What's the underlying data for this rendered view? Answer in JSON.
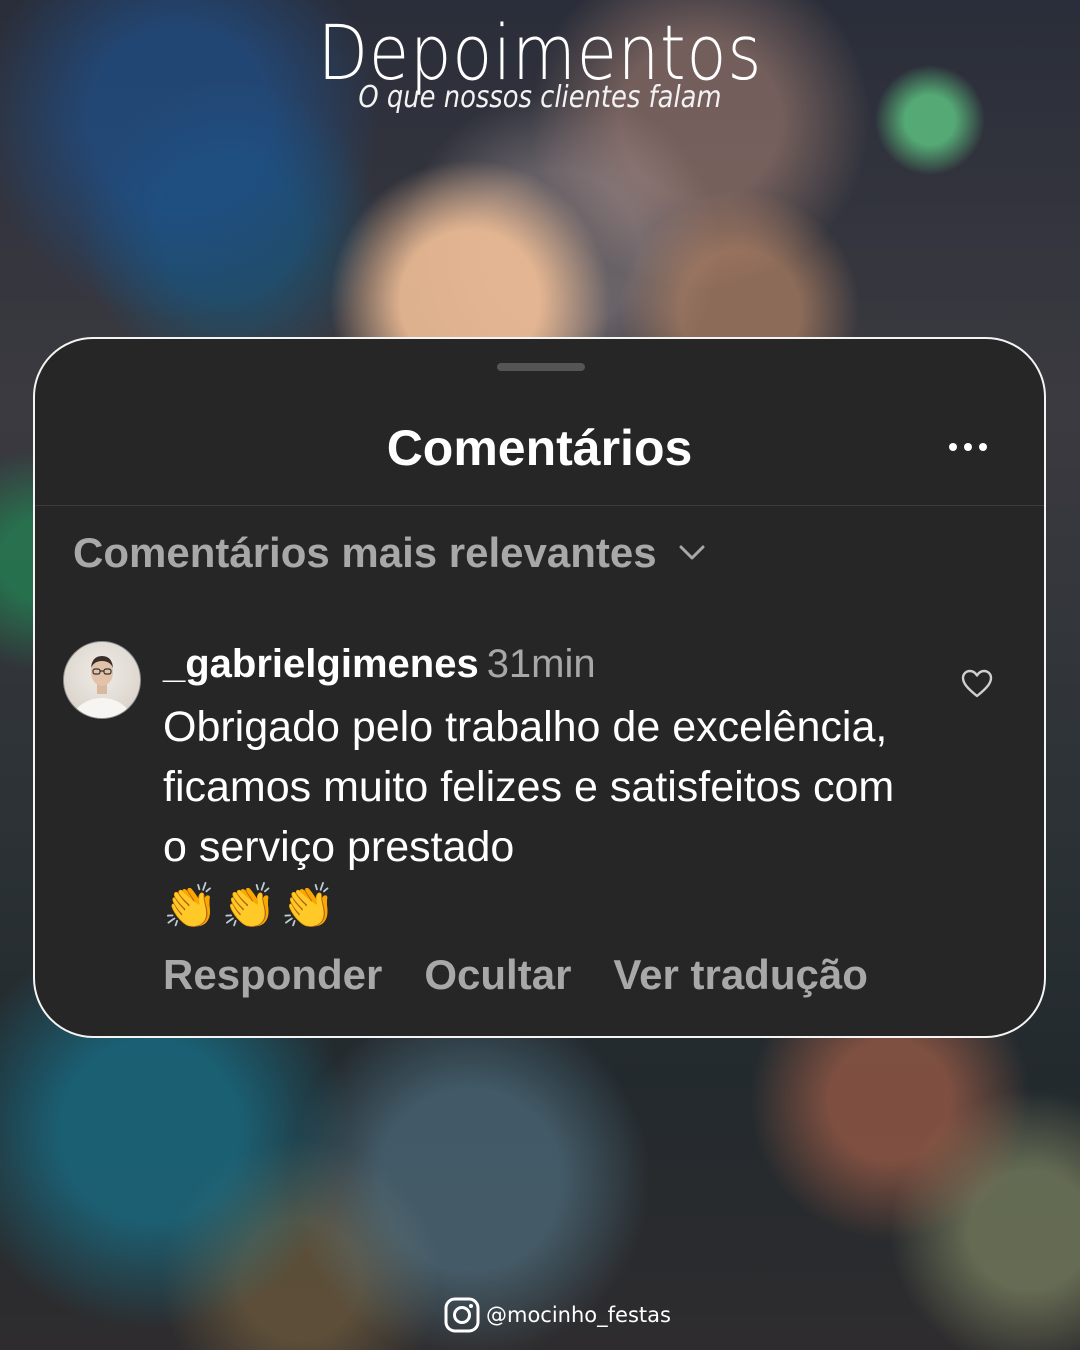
{
  "header": {
    "title": "Depoimentos",
    "subtitle": "O que nossos clientes falam"
  },
  "panel": {
    "title": "Comentários",
    "more_icon": "more-horizontal-icon",
    "sort_label": "Comentários mais relevantes",
    "sort_icon": "chevron-down-icon"
  },
  "comment": {
    "username": "_gabrielgimenes",
    "time": "31min",
    "text": "Obrigado pelo trabalho de excelência, ficamos muito felizes e satisfeitos com o serviço prestado",
    "emojis": "👏👏👏",
    "like_icon": "heart-icon",
    "actions": {
      "reply": "Responder",
      "hide": "Ocultar",
      "translate": "Ver tradução"
    }
  },
  "footer": {
    "icon": "instagram-icon",
    "handle": "@mocinho_festas"
  },
  "colors": {
    "panel_bg": "#262626",
    "muted_text": "#a8a8a8",
    "border": "#f4f4f4"
  }
}
